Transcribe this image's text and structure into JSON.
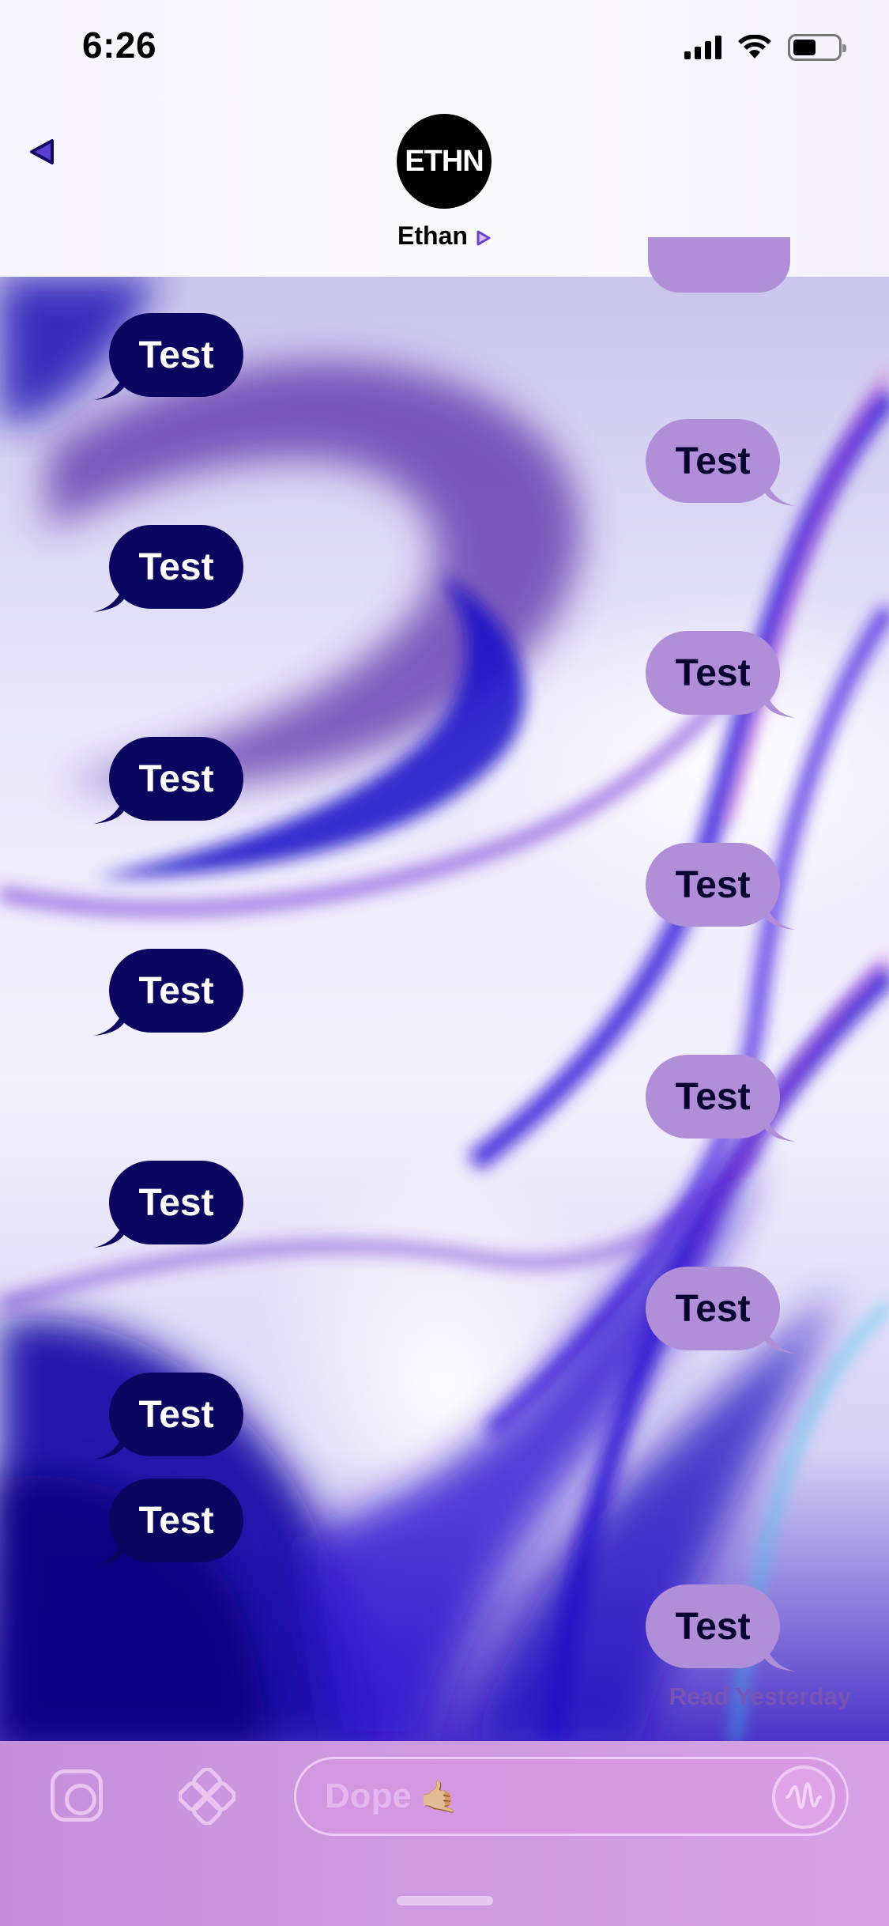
{
  "status_bar": {
    "time": "6:26"
  },
  "header": {
    "avatar_text": "ETHN",
    "contact_name": "Ethan"
  },
  "messages": [
    {
      "direction": "in",
      "text": "Test"
    },
    {
      "direction": "out",
      "text": "Test"
    },
    {
      "direction": "in",
      "text": "Test"
    },
    {
      "direction": "out",
      "text": "Test"
    },
    {
      "direction": "in",
      "text": "Test"
    },
    {
      "direction": "out",
      "text": "Test"
    },
    {
      "direction": "in",
      "text": "Test"
    },
    {
      "direction": "out",
      "text": "Test"
    },
    {
      "direction": "in",
      "text": "Test"
    },
    {
      "direction": "out",
      "text": "Test"
    },
    {
      "direction": "in",
      "text": "Test"
    },
    {
      "direction": "in",
      "text": "Test"
    },
    {
      "direction": "out",
      "text": "Test"
    }
  ],
  "read_receipt": "Read Yesterday",
  "composer": {
    "placeholder": "Dope",
    "emoji": "🤙🏼",
    "icons": [
      "camera-icon",
      "apps-icon",
      "audio-wave-icon"
    ]
  },
  "colors": {
    "incoming_bubble": "#0b0660",
    "outgoing_bubble": "#b18ed8",
    "read_receipt": "#7a54b4",
    "composer": "#cc99e0"
  }
}
